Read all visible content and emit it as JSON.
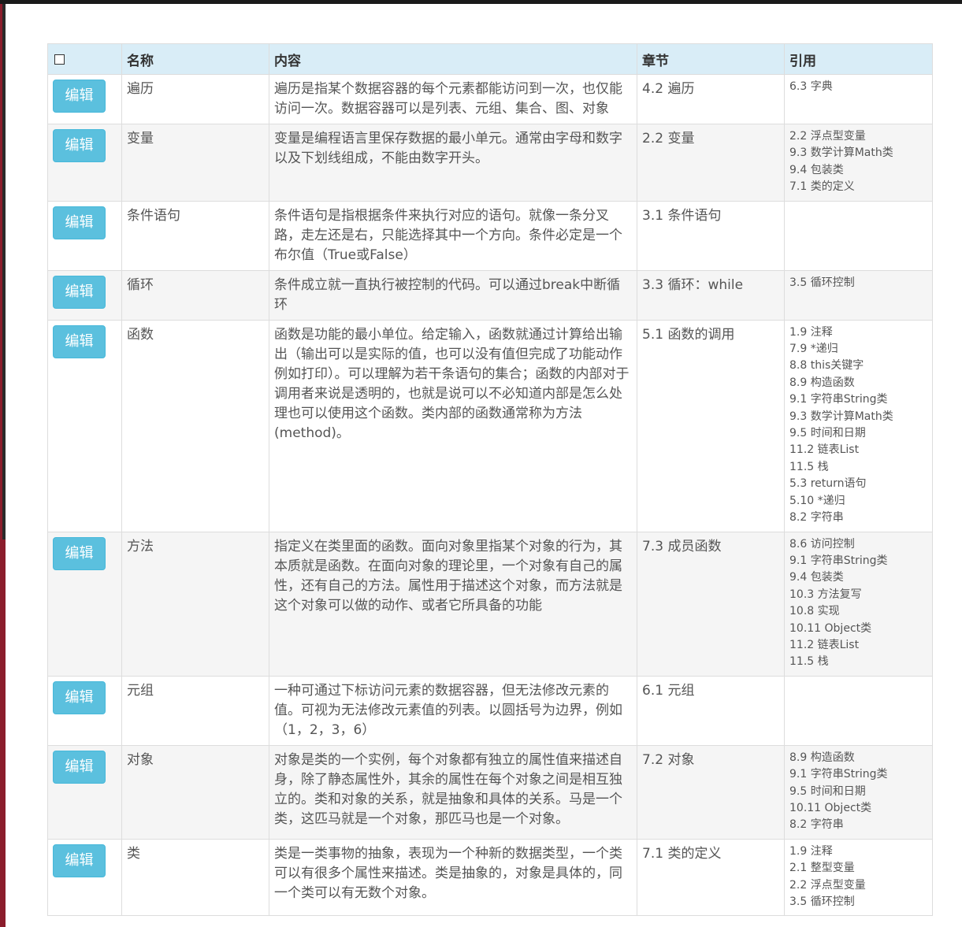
{
  "table": {
    "headers": {
      "name": "名称",
      "content": "内容",
      "chapter": "章节",
      "refs": "引用"
    },
    "edit_label": "编辑",
    "rows": [
      {
        "name": "遍历",
        "content": "遍历是指某个数据容器的每个元素都能访问到一次，也仅能访问一次。数据容器可以是列表、元组、集合、图、对象",
        "chapter": "4.2 遍历",
        "refs": [
          "6.3 字典"
        ]
      },
      {
        "name": "变量",
        "content": "变量是编程语言里保存数据的最小单元。通常由字母和数字以及下划线组成，不能由数字开头。",
        "chapter": "2.2 变量",
        "refs": [
          "2.2 浮点型变量",
          "9.3 数学计算Math类",
          "9.4 包装类",
          "7.1 类的定义"
        ]
      },
      {
        "name": "条件语句",
        "content": "条件语句是指根据条件来执行对应的语句。就像一条分叉路，走左还是右，只能选择其中一个方向。条件必定是一个布尔值（True或False）",
        "chapter": "3.1 条件语句",
        "refs": []
      },
      {
        "name": "循环",
        "content": "条件成立就一直执行被控制的代码。可以通过break中断循环",
        "chapter": "3.3 循环：while",
        "refs": [
          "3.5 循环控制"
        ]
      },
      {
        "name": "函数",
        "content": "函数是功能的最小单位。给定输入，函数就通过计算给出输出（输出可以是实际的值，也可以没有值但完成了功能动作例如打印）。可以理解为若干条语句的集合；函数的内部对于调用者来说是透明的，也就是说可以不必知道内部是怎么处理也可以使用这个函数。类内部的函数通常称为方法 (method)。",
        "chapter": "5.1 函数的调用",
        "refs": [
          "1.9 注释",
          "7.9 *递归",
          "8.8 this关键字",
          "8.9 构造函数",
          "9.1 字符串String类",
          "9.3 数学计算Math类",
          "9.5 时间和日期",
          "11.2 链表List",
          "11.5 栈",
          "5.3 return语句",
          "5.10 *递归",
          "8.2 字符串"
        ]
      },
      {
        "name": "方法",
        "content": "指定义在类里面的函数。面向对象里指某个对象的行为，其本质就是函数。在面向对象的理论里，一个对象有自己的属性，还有自己的方法。属性用于描述这个对象，而方法就是这个对象可以做的动作、或者它所具备的功能",
        "chapter": "7.3 成员函数",
        "refs": [
          "8.6 访问控制",
          "9.1 字符串String类",
          "9.4 包装类",
          "10.3 方法复写",
          "10.8 实现",
          "10.11 Object类",
          "11.2 链表List",
          "11.5 栈"
        ]
      },
      {
        "name": "元组",
        "content": "一种可通过下标访问元素的数据容器，但无法修改元素的值。可视为无法修改元素值的列表。以圆括号为边界，例如 （1，2，3，6）",
        "chapter": "6.1 元组",
        "refs": []
      },
      {
        "name": "对象",
        "content": "对象是类的一个实例，每个对象都有独立的属性值来描述自身，除了静态属性外，其余的属性在每个对象之间是相互独立的。类和对象的关系，就是抽象和具体的关系。马是一个类，这匹马就是一个对象，那匹马也是一个对象。",
        "chapter": "7.2 对象",
        "refs": [
          "8.9 构造函数",
          "9.1 字符串String类",
          "9.5 时间和日期",
          "10.11 Object类",
          "8.2 字符串"
        ]
      },
      {
        "name": "类",
        "content": "类是一类事物的抽象，表现为一个种新的数据类型，一个类可以有很多个属性来描述。类是抽象的，对象是具体的，同一个类可以有无数个对象。",
        "chapter": "7.1 类的定义",
        "refs": [
          "1.9 注释",
          "2.1 整型变量",
          "2.2 浮点型变量",
          "3.5 循环控制"
        ]
      }
    ]
  }
}
